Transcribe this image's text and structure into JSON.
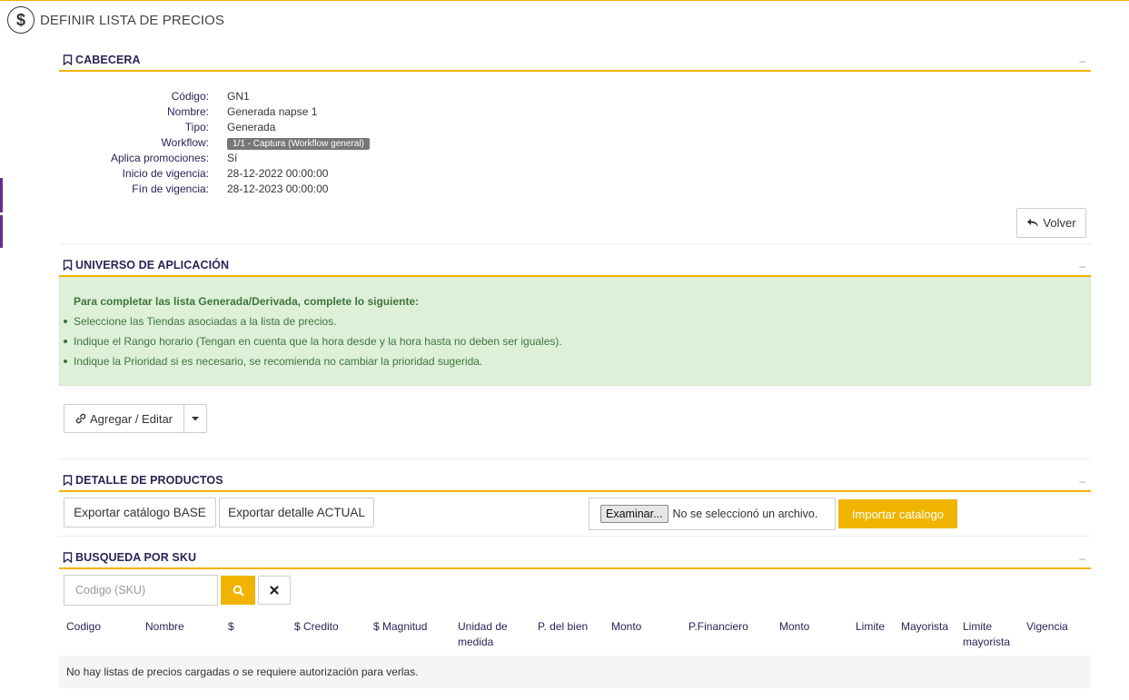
{
  "page": {
    "title": "DEFINIR LISTA DE PRECIOS",
    "icon": "dollar-circle-icon"
  },
  "colors": {
    "accent": "#f0b400",
    "heading": "#2e2255",
    "sidebar_accent": "#6a2c8f",
    "alert_bg": "#dff0d8",
    "alert_text": "#3c763d"
  },
  "cabecera": {
    "title": "CABECERA",
    "collapse": "–",
    "fields": [
      {
        "key": "Código:",
        "value": "GN1"
      },
      {
        "key": "Nombre:",
        "value": "Generada napse 1"
      },
      {
        "key": "Tipo:",
        "value": "Generada"
      },
      {
        "key": "Workflow:",
        "value": "1/1 - Captura (Workflow general)"
      },
      {
        "key": "Aplica promociones:",
        "value": "Sí"
      },
      {
        "key": "Inicio de vigencia:",
        "value": "28-12-2022 00:00:00"
      },
      {
        "key": "Fín de vigencia:",
        "value": "28-12-2023 00:00:00"
      }
    ],
    "back_label": "Volver"
  },
  "universo": {
    "title": "UNIVERSO DE APLICACIÓN",
    "collapse": "–",
    "alert_title": "Para completar las lista Generada/Derivada, complete lo siguiente:",
    "alert_items": [
      "Seleccione las Tiendas asociadas a la lista de precios.",
      "Indique el Rango horario (Tengan en cuenta que la hora desde y la hora hasta no deben ser iguales).",
      "Indique la Prioridad si es necesario, se recomienda no cambiar la prioridad sugerida."
    ],
    "add_edit_label": "Agregar / Editar"
  },
  "detalle": {
    "title": "DETALLE DE PRODUCTOS",
    "collapse": "–",
    "export_base_label": "Exportar catálogo BASE",
    "export_actual_label": "Exportar detalle ACTUAL",
    "browse_label": "Examinar...",
    "no_file_text": "No se seleccionó un archivo.",
    "import_label": "Importar catalogo"
  },
  "busqueda": {
    "title": "BUSQUEDA POR SKU",
    "collapse": "–",
    "sku_placeholder": "Codigo (SKU)",
    "columns": [
      {
        "line1": "Codigo",
        "line2": ""
      },
      {
        "line1": "Nombre",
        "line2": ""
      },
      {
        "line1": "$",
        "line2": ""
      },
      {
        "line1": "$ Credito",
        "line2": ""
      },
      {
        "line1": "$ Magnitud",
        "line2": ""
      },
      {
        "line1": "Unidad de",
        "line2": "medida"
      },
      {
        "line1": "P. del bien",
        "line2": ""
      },
      {
        "line1": "Monto",
        "line2": ""
      },
      {
        "line1": "P.Financiero",
        "line2": ""
      },
      {
        "line1": "Monto",
        "line2": ""
      },
      {
        "line1": "Limite",
        "line2": ""
      },
      {
        "line1": "Mayorista",
        "line2": ""
      },
      {
        "line1": "Limite",
        "line2": "mayorista"
      },
      {
        "line1": "Vigencia",
        "line2": ""
      }
    ],
    "empty_message": "No hay listas de precios cargadas o se requiere autorización para verlas."
  }
}
